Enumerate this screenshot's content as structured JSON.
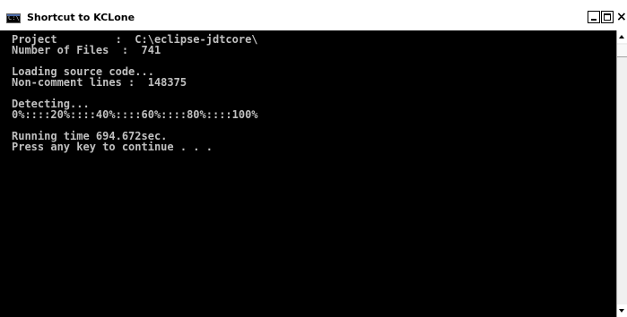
{
  "window": {
    "title": "Shortcut to KCLone",
    "icon": "console-icon",
    "icon_text": "C:\\",
    "controls": {
      "minimize": "minimize-icon",
      "maximize": "maximize-icon",
      "close": "×"
    }
  },
  "console": {
    "lines": [
      "Project         :  C:\\eclipse-jdtcore\\",
      "Number of Files  :  741",
      "",
      "Loading source code...",
      "Non-comment lines :  148375",
      "",
      "Detecting...",
      "0%::::20%::::40%::::60%::::80%::::100%",
      "",
      "Running time 694.672sec.",
      "Press any key to continue . . ."
    ]
  },
  "colors": {
    "console_background": "#000000",
    "console_text": "#c0c0c0",
    "titlebar_background": "#ffffff"
  }
}
